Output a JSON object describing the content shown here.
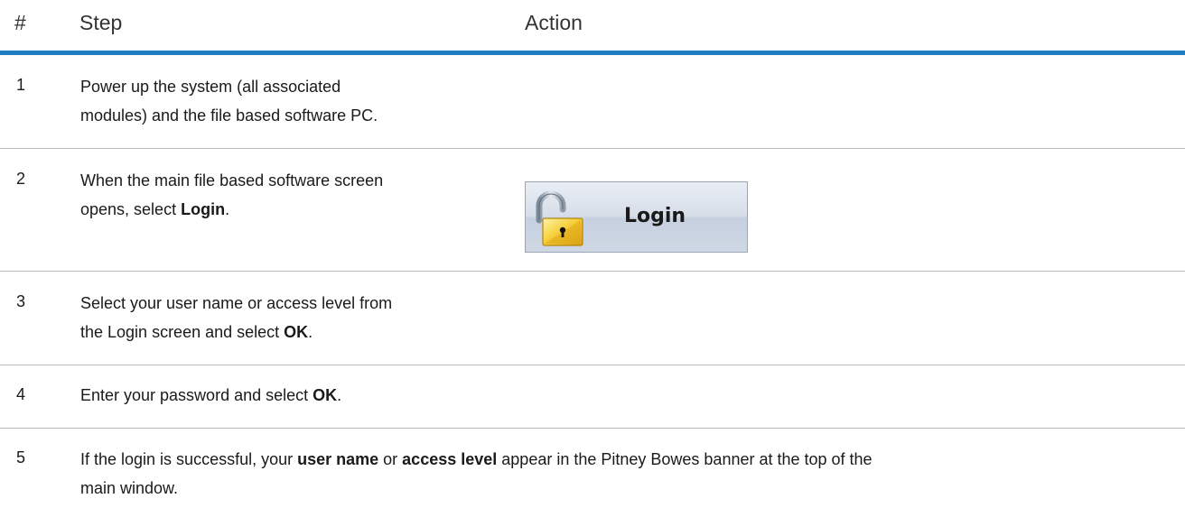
{
  "header": {
    "num": "#",
    "step": "Step",
    "action": "Action"
  },
  "rows": [
    {
      "num": "1",
      "line1": "Power up the system (all associated",
      "line2": "modules) and the file based software PC."
    },
    {
      "num": "2",
      "line1": "When the main file based software screen",
      "line2_pre": "opens, select ",
      "line2_bold": "Login",
      "line2_post": "."
    },
    {
      "num": "3",
      "line1": "Select your user name or access level from",
      "line2_pre": "the Login screen and select ",
      "line2_bold": "OK",
      "line2_post": "."
    },
    {
      "num": "4",
      "line1_pre": "Enter your password and select ",
      "line1_bold": "OK",
      "line1_post": "."
    },
    {
      "num": "5",
      "line1_pre": "If the login is successful, your ",
      "line1_bold1": "user name",
      "line1_mid": " or ",
      "line1_bold2": "access level",
      "line1_post": " appear in the Pitney Bowes banner at the top of the",
      "line2": "main window."
    }
  ],
  "login_button": {
    "label": "Login",
    "icon": "padlock-open-icon"
  },
  "colors": {
    "header_rule": "#1f7dc4",
    "separator": "#bcbcbc"
  }
}
